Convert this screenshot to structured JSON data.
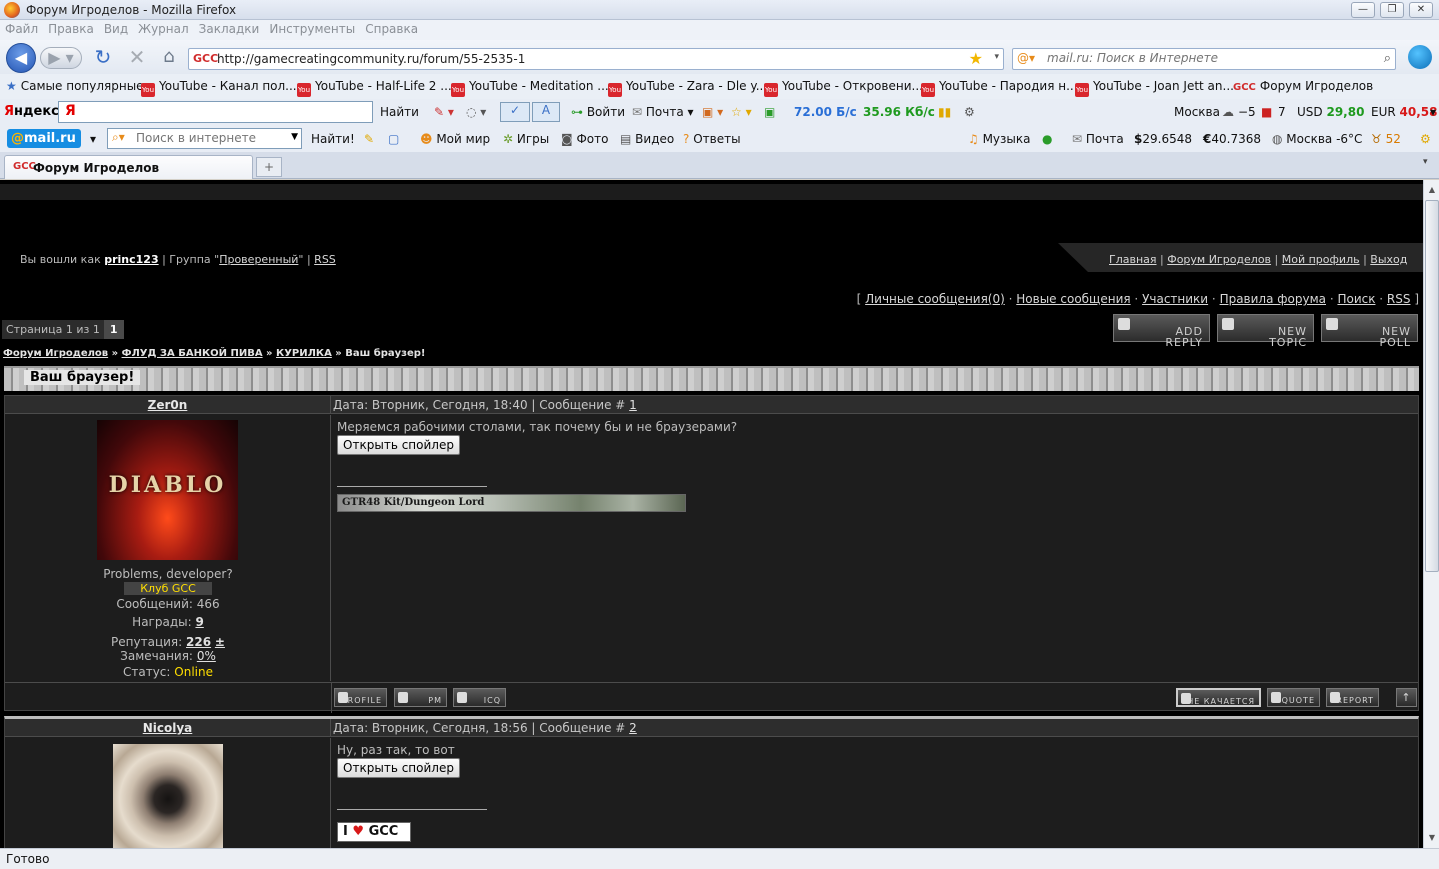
{
  "window": {
    "title": "Форум Игроделов - Mozilla Firefox",
    "controls": [
      "—",
      "❐",
      "✕"
    ]
  },
  "menubar": [
    "Файл",
    "Правка",
    "Вид",
    "Журнал",
    "Закладки",
    "Инструменты",
    "Справка"
  ],
  "navbar": {
    "back_icon": "◀",
    "forward_icon": "▶ ▾",
    "reload_icon": "↻",
    "stop_icon": "✕",
    "home_icon": "⌂",
    "site_icon": "GCC",
    "url": "http://gamecreatingcommunity.ru/forum/55-2535-1",
    "star": "★",
    "dropdown": "▾",
    "search_engine_icon": "@▾",
    "search_placeholder": "mail.ru: Поиск в Интернете",
    "search_go": "⌕"
  },
  "bookmarks": [
    {
      "label": "Самые популярные",
      "icon": "star-icon"
    },
    {
      "label": "YouTube - Канал пол...",
      "icon": "youtube-icon"
    },
    {
      "label": "YouTube - Half-Life 2 ...",
      "icon": "youtube-icon"
    },
    {
      "label": "YouTube - Meditation ...",
      "icon": "youtube-icon"
    },
    {
      "label": "YouTube - Zara - Dle y...",
      "icon": "youtube-icon"
    },
    {
      "label": "YouTube - Откровени...",
      "icon": "youtube-icon"
    },
    {
      "label": "YouTube - Пародия н...",
      "icon": "youtube-icon"
    },
    {
      "label": "YouTube - Joan Jett an...",
      "icon": "youtube-icon"
    },
    {
      "label": "Форум Игроделов",
      "icon": "gcc-icon"
    }
  ],
  "yandex_bar": {
    "logo_prefix": "Я",
    "logo_suffix": "ндекс ▾",
    "input_mark": "Я",
    "find": "Найти",
    "login": "Войти",
    "mail": "Почта ▾",
    "speed_down": "72.00 Б/с",
    "speed_up": "35.96 Кб/с",
    "city": "Москва",
    "temp": "−5",
    "traffic": "7",
    "usd_label": "USD",
    "usd_value": "29,80",
    "eur_label": "EUR",
    "eur_value": "40,58"
  },
  "mail_bar": {
    "logo_at": "@",
    "logo_text": "mail.ru",
    "search_placeholder": "Поиск в интернете",
    "find": "Найти!",
    "links": [
      "Мой мир",
      "Игры",
      "Фото",
      "Видео",
      "Ответы"
    ],
    "music": "Музыка",
    "mail": "Почта",
    "usd": "29.6548",
    "eur": "40.7368",
    "weather": "Москва -6°C",
    "count": "52",
    "usd_sign": "$",
    "eur_sign": "€"
  },
  "tabs": [
    {
      "label": "Форум Игроделов",
      "icon": "GCC"
    }
  ],
  "newtab": "+",
  "page": {
    "login_prefix": "Вы вошли как",
    "username": "princ123",
    "group_prefix": "| Группа \"",
    "group": "Проверенный",
    "group_suffix": "\" |",
    "rss": "RSS",
    "topnav": [
      "Главная",
      "Форум Игроделов",
      "Мой профиль",
      "Выход"
    ],
    "usernav": [
      "Личные сообщения(0)",
      "Новые сообщения",
      "Участники",
      "Правила форума",
      "Поиск",
      "RSS"
    ],
    "pager_label": "Страница 1 из 1",
    "pager_current": "1",
    "buttons": {
      "add_reply": [
        "ADD",
        "REPLY"
      ],
      "new_topic": [
        "NEW",
        "TOPIC"
      ],
      "new_poll": [
        "NEW",
        "POLL"
      ]
    },
    "breadcrumbs": [
      "Форум Игроделов",
      "ФЛУД ЗА БАНКОЙ ПИВА",
      "КУРИЛКА",
      "Ваш браузер!"
    ],
    "topic_title": "Ваш браузер!",
    "posts": [
      {
        "author": "Zer0n",
        "date": "Дата: Вторник, Сегодня, 18:40 | Сообщение #",
        "num": "1",
        "text": "Меряемся рабочими столами, так почему бы и не браузерами?",
        "spoiler": "Открыть спойлер",
        "avatar_text": "DIABLO",
        "title": "Problems, developer?",
        "club": "Клуб GCC",
        "messages_label": "Сообщений:",
        "messages": "466",
        "awards_label": "Награды:",
        "awards": "9",
        "rep_label": "Репутация:",
        "rep": "226",
        "rep_pm": "±",
        "warn_label": "Замечания:",
        "warn": "0%",
        "status_label": "Статус:",
        "status": "Online",
        "signature": "GTR48 Kit/Dungeon Lord",
        "foot_left": [
          "PROFILE",
          "PM",
          "ICQ"
        ],
        "foot_right": [
          "НЕ КАЧАЕТСЯ",
          "QUOTE",
          "REPORT"
        ],
        "top_icon": "↑"
      },
      {
        "author": "Nicolya",
        "date": "Дата: Вторник, Сегодня, 18:56 | Сообщение #",
        "num": "2",
        "text": "Ну, раз так, то вот",
        "spoiler": "Открыть спойлер",
        "sig_prefix": "I",
        "sig_heart": "♥",
        "sig_text": "GCC"
      }
    ]
  },
  "status_text": "Готово"
}
